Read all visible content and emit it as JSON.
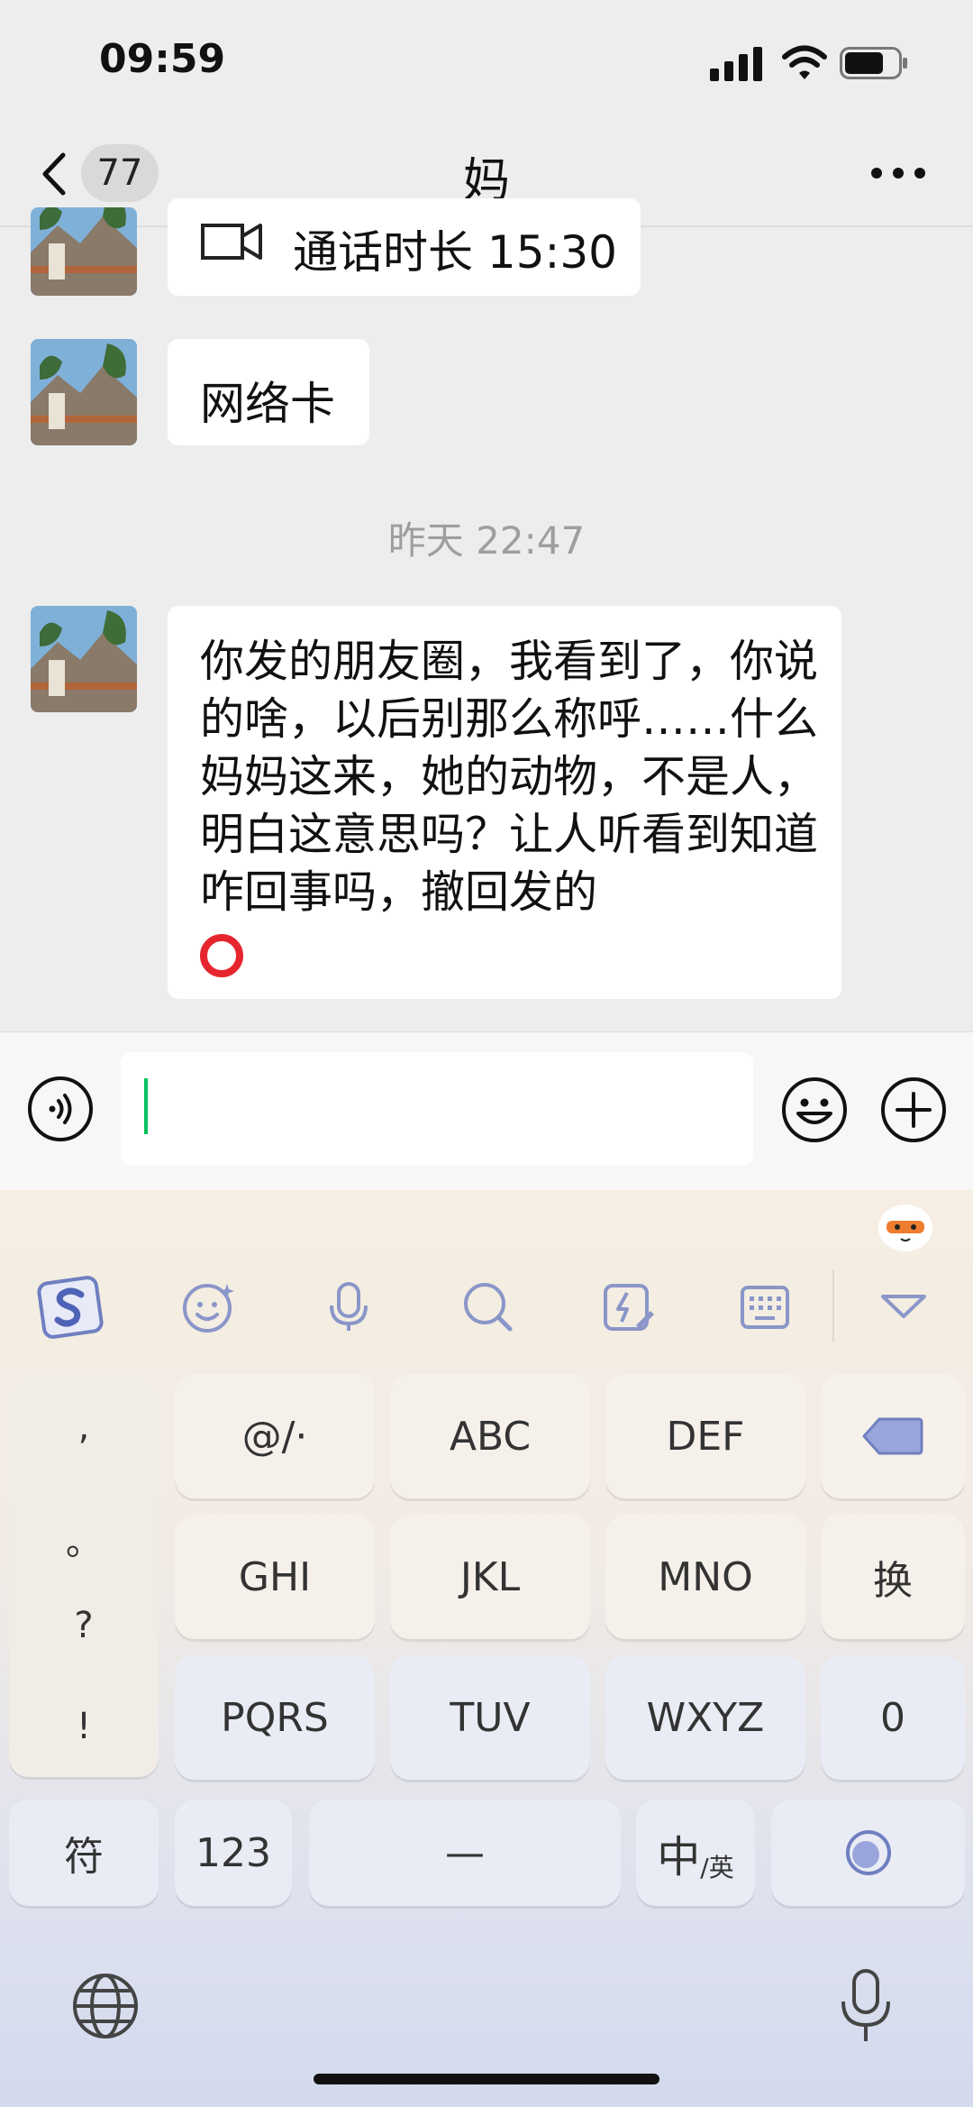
{
  "status_bar": {
    "time": "09:59"
  },
  "nav": {
    "unread_count": "77",
    "title": "妈"
  },
  "messages": {
    "call": {
      "text": "通话时长 15:30"
    },
    "msg2": {
      "text": "网络卡"
    },
    "timestamp": "昨天 22:47",
    "msg3": {
      "text": "你发的朋友圈，我看到了，你说的啥，以后别那么称呼……什么妈妈这来，她的动物，不是人，明白这意思吗？让人听看到知道咋回事吗，撤回发的"
    }
  },
  "keyboard": {
    "punctuation": [
      ",",
      "。",
      "?",
      "!"
    ],
    "row1": [
      "@/·",
      "ABC",
      "DEF"
    ],
    "row2": [
      "GHI",
      "JKL",
      "MNO",
      "换"
    ],
    "row3": [
      "PQRS",
      "TUV",
      "WXYZ",
      "0"
    ],
    "bottom": {
      "symbols": "符",
      "numbers": "123",
      "space": "—",
      "lang_main": "中",
      "lang_sub": "/英"
    }
  },
  "icons": [
    "back-chevron-icon",
    "more-icon",
    "video-call-icon",
    "voice-icon",
    "emoji-icon",
    "plus-icon",
    "sogou-logo-icon",
    "keyboard-emoji-icon",
    "mic-icon",
    "search-icon",
    "quick-phrase-icon",
    "keyboard-layout-icon",
    "collapse-icon",
    "backspace-icon",
    "enter-icon",
    "globe-icon"
  ]
}
